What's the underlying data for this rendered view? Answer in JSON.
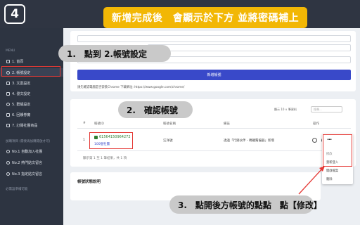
{
  "step_number": "4",
  "headline": "新增完成後　會顯示於下方 並將密碼補上",
  "sidebar": {
    "menu_label": "MENU",
    "items": [
      {
        "label": "1. 首頁"
      },
      {
        "label": "2. 帳號設定"
      },
      {
        "label": "3. 文案設定"
      },
      {
        "label": "4. 發文設定"
      },
      {
        "label": "5. 群組設定"
      },
      {
        "label": "6. 回饋券實"
      },
      {
        "label": "7. 訂閱社團商品"
      }
    ],
    "section2_label": "加購項目 (需要再加購開啟才可)",
    "items2": [
      {
        "label": "No.1 自動加入社團"
      },
      {
        "label": "No.2 熱門貼文留言"
      },
      {
        "label": "No.3 指定貼文留言"
      }
    ],
    "section3_label": "必需設準權可能"
  },
  "form": {
    "add_button": "新增帳號",
    "hint": "請先確認電腦是否安裝Chrome 下載網址: https://www.google.com/chrome/"
  },
  "callouts": {
    "one": "1.　點到 2.帳號設定",
    "two": "2.　確認帳號",
    "three": "3.　點開後方帳號的點點　點【修改】"
  },
  "table": {
    "show_label": "顯示 10 ∨ 筆資料",
    "search_placeholder": "搜尋...",
    "headers": [
      "#",
      "帳號ID",
      "帳號名稱",
      "備註",
      "操作"
    ],
    "row": {
      "index": "1",
      "account_id": "61564150964272",
      "account_link": "100個社團",
      "account_name": "汪洋號",
      "remark": "透過「行銷伙伴 - 螞蟻幫偏器」新增"
    },
    "summary": "顯示第 1 至 1 筆結果，共 1 項"
  },
  "menu_icon": "more-dots-icon",
  "dropdown_items": [
    "修改",
    "重新登入",
    "開啟檔案",
    "刪除"
  ],
  "section_title": "帳號狀態說明",
  "colors": {
    "highlight_red": "#e53935",
    "headline_yellow": "#f2b705",
    "primary_blue": "#3949c9",
    "sidebar_dark": "#2d3441"
  }
}
